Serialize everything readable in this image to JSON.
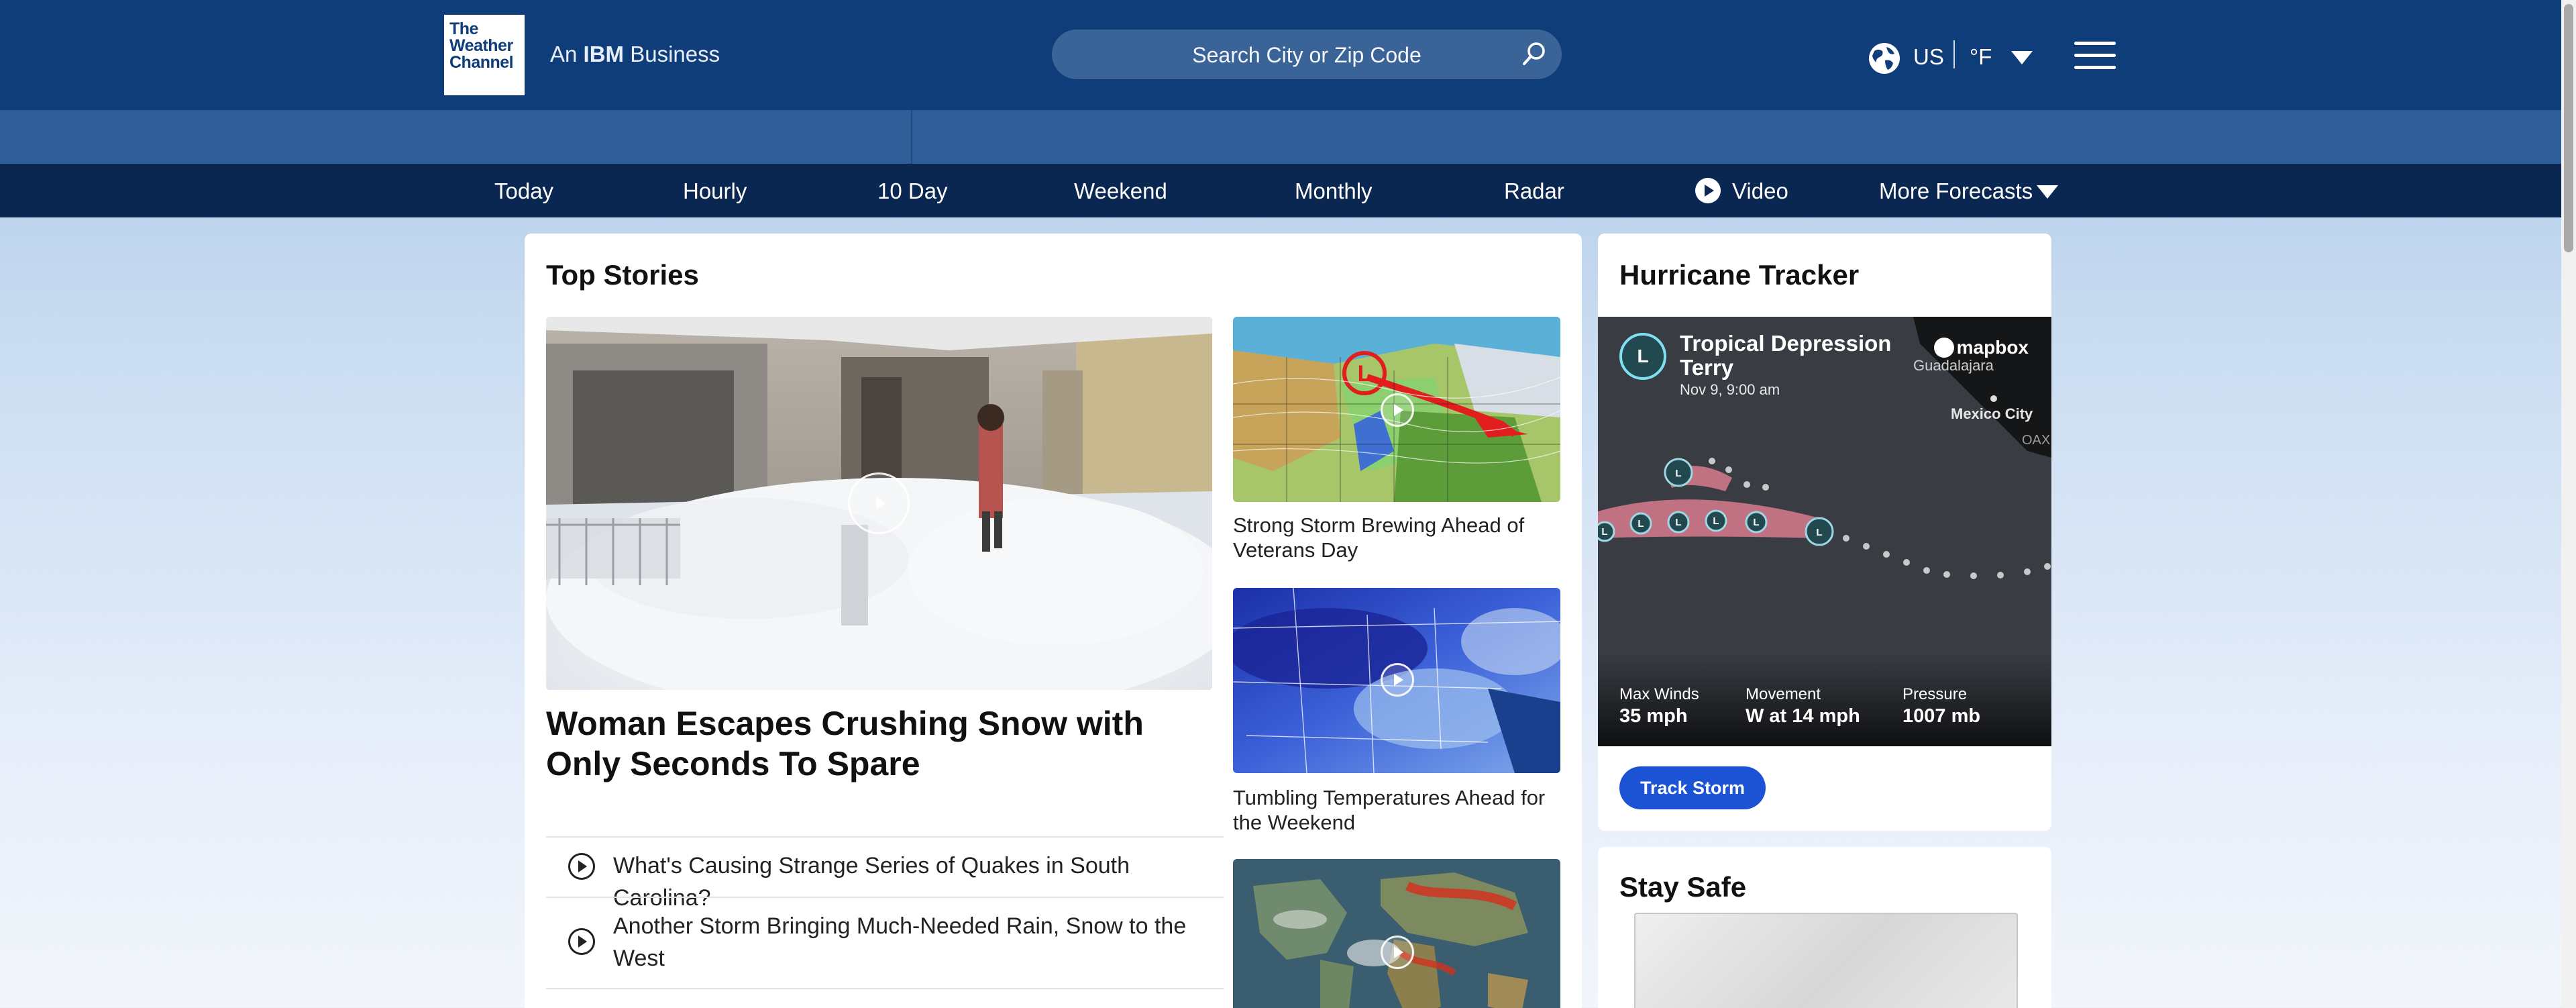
{
  "header": {
    "logo_lines": [
      "The",
      "Weather",
      "Channel"
    ],
    "ibm_prefix": "An",
    "ibm_brand": "IBM",
    "ibm_suffix": "Business",
    "search_placeholder": "Search City or Zip Code",
    "search_icon": "search-icon",
    "region": "US",
    "unit": "°F",
    "globe_icon": "globe-icon",
    "menu_icon": "hamburger-menu-icon"
  },
  "colors": {
    "header_bg": "#0f3d7a",
    "nav_bg": "#0a2752",
    "accent_button": "#1c52d4",
    "storm_ring": "#7fe0f0"
  },
  "nav": {
    "items": [
      "Today",
      "Hourly",
      "10 Day",
      "Weekend",
      "Monthly",
      "Radar",
      "Video",
      "More Forecasts"
    ]
  },
  "top_stories": {
    "title": "Top Stories",
    "hero_headline": "Woman Escapes Crushing Snow with Only Seconds To Spare",
    "thumbs": [
      {
        "caption": "Strong Storm Brewing Ahead of Veterans Day"
      },
      {
        "caption": "Tumbling Temperatures Ahead for the Weekend"
      },
      {
        "caption": ""
      }
    ],
    "list": [
      "What's Causing Strange Series of Quakes in South Carolina?",
      "Another Storm Bringing Much-Needed Rain, Snow to the West"
    ]
  },
  "hurricane": {
    "title": "Hurricane Tracker",
    "badge": "L",
    "storm_name": "Tropical Depression Terry",
    "time": "Nov 9, 9:00 am",
    "map_brand": "mapbox",
    "map_labels": [
      "Guadalajara",
      "Mexico City",
      "OAX"
    ],
    "stats": [
      {
        "label": "Max Winds",
        "value": "35 mph"
      },
      {
        "label": "Movement",
        "value": "W at 14 mph"
      },
      {
        "label": "Pressure",
        "value": "1007 mb"
      }
    ],
    "button": "Track Storm"
  },
  "stay_safe": {
    "title": "Stay Safe"
  }
}
